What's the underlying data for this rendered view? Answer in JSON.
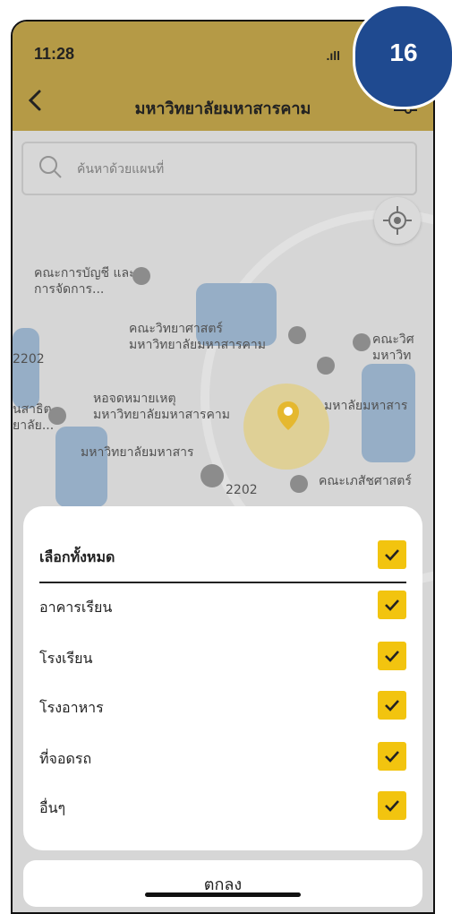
{
  "status": {
    "time": "11:28",
    "signal": ".ıll"
  },
  "header": {
    "title": "มหาวิทยาลัยมหาสารคาม"
  },
  "badge": {
    "number": "16"
  },
  "search": {
    "placeholder": "ค้นหาด้วยแผนที่"
  },
  "map": {
    "labels": [
      "คณะการบัญชี และการจัดการ...",
      "คณะวิทยาศาสตร์ มหาวิทยาลัยมหาสารคาม",
      "หอจดหมายเหตุ มหาวิทยาลัยมหาสารคาม",
      "มหาลัยมหาสาร",
      "มหาวิทยาลัยมหาสาร",
      "คณะเภสัชศาสตร์",
      "คณะวิศ มหาวิท",
      "นสาธิต ยาลัย...",
      "2202"
    ]
  },
  "filter": {
    "select_all": "เลือกทั้งหมด",
    "items": [
      {
        "label": "อาคารเรียน",
        "checked": true
      },
      {
        "label": "โรงเรียน",
        "checked": true
      },
      {
        "label": "โรงอาหาร",
        "checked": true
      },
      {
        "label": "ที่จอดรถ",
        "checked": true
      },
      {
        "label": "อื่นๆ",
        "checked": true
      }
    ]
  },
  "confirm": {
    "label": "ตกลง"
  },
  "colors": {
    "header": "#b59a46",
    "accent": "#f2c40f",
    "badge": "#1f4a90"
  },
  "icons": {
    "back": "chevron-left-icon",
    "filter": "sliders-icon",
    "search": "search-icon",
    "locate": "crosshair-icon",
    "check": "check-icon"
  }
}
